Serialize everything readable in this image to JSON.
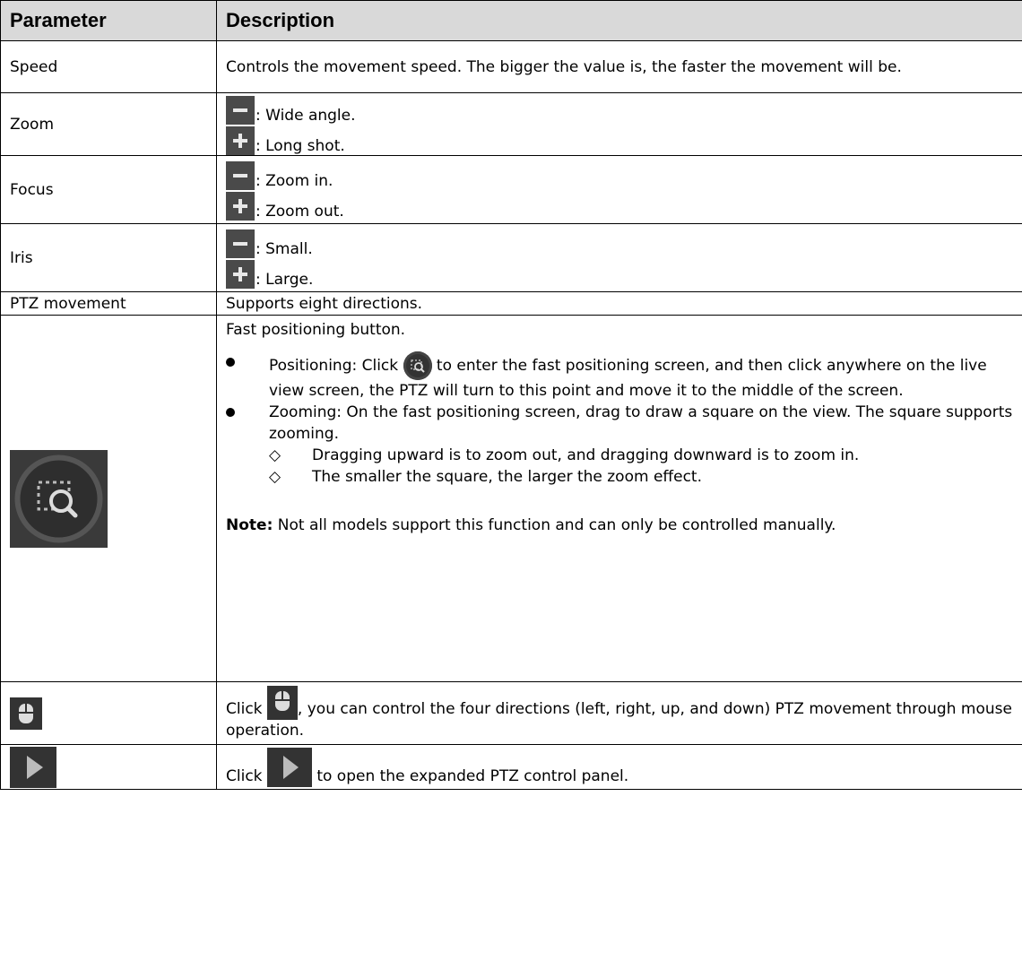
{
  "header": {
    "param": "Parameter",
    "desc": "Description"
  },
  "rows": {
    "speed": {
      "param": "Speed",
      "desc": "Controls the movement speed. The bigger the value is, the faster the movement will be."
    },
    "zoom": {
      "param": "Zoom",
      "minus_text": ": Wide angle.",
      "plus_text": ": Long shot."
    },
    "focus": {
      "param": "Focus",
      "minus_text": ": Zoom in.",
      "plus_text": ": Zoom out."
    },
    "iris": {
      "param": "Iris",
      "minus_text": ": Small.",
      "plus_text": ": Large."
    },
    "ptz": {
      "param": "PTZ movement",
      "desc": "Supports eight directions."
    },
    "fast": {
      "intro": "Fast positioning button.",
      "positioning_pre": "Positioning: Click",
      "positioning_post": " to enter the fast positioning screen, and then click anywhere on the live view screen, the PTZ will turn to this point and move it to the middle of the screen.",
      "zooming": "Zooming: On the fast positioning screen, drag to draw a square on the view. The square supports zooming.",
      "sub1": "Dragging upward is to zoom out, and dragging downward is to zoom in.",
      "sub2": "The smaller the square, the larger the zoom effect.",
      "note_label": "Note:",
      "note_text": " Not all models support this function and can only be controlled manually."
    },
    "mouse": {
      "pre": "Click",
      "post": ", you can control the four directions (left, right, up, and down) PTZ movement through mouse operation."
    },
    "expand": {
      "pre": "Click",
      "post": " to open the expanded PTZ control panel."
    }
  },
  "colors": {
    "header_bg": "#d9d9d9",
    "icon_bg": "#4a4a4a",
    "icon_fg": "#e8e8e8"
  },
  "icons": [
    "minus-icon",
    "plus-icon",
    "fast-positioning-icon",
    "mouse-icon",
    "expand-arrow-icon",
    "bullet-dot-icon",
    "diamond-bullet-icon"
  ]
}
